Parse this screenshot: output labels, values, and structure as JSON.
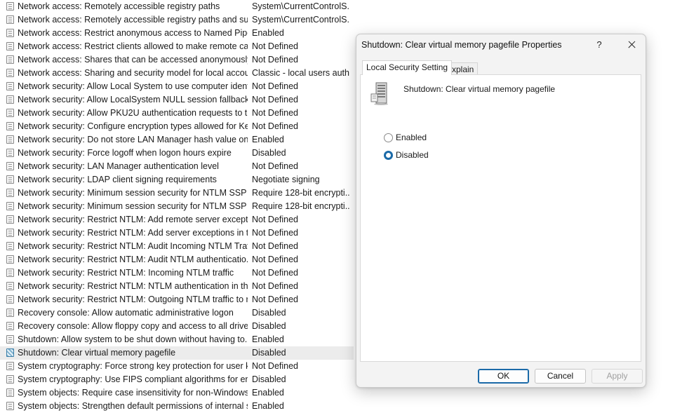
{
  "policies": [
    {
      "name": "Network access: Remotely accessible registry paths",
      "setting": "System\\CurrentControlS..."
    },
    {
      "name": "Network access: Remotely accessible registry paths and sub...",
      "setting": "System\\CurrentControlS..."
    },
    {
      "name": "Network access: Restrict anonymous access to Named Pipes...",
      "setting": "Enabled"
    },
    {
      "name": "Network access: Restrict clients allowed to make remote call...",
      "setting": "Not Defined"
    },
    {
      "name": "Network access: Shares that can be accessed anonymously",
      "setting": "Not Defined"
    },
    {
      "name": "Network access: Sharing and security model for local accou...",
      "setting": "Classic - local users auth..."
    },
    {
      "name": "Network security: Allow Local System to use computer ident...",
      "setting": "Not Defined"
    },
    {
      "name": "Network security: Allow LocalSystem NULL session fallback",
      "setting": "Not Defined"
    },
    {
      "name": "Network security: Allow PKU2U authentication requests to t...",
      "setting": "Not Defined"
    },
    {
      "name": "Network security: Configure encryption types allowed for Ke...",
      "setting": "Not Defined"
    },
    {
      "name": "Network security: Do not store LAN Manager hash value on ...",
      "setting": "Enabled"
    },
    {
      "name": "Network security: Force logoff when logon hours expire",
      "setting": "Disabled"
    },
    {
      "name": "Network security: LAN Manager authentication level",
      "setting": "Not Defined"
    },
    {
      "name": "Network security: LDAP client signing requirements",
      "setting": "Negotiate signing"
    },
    {
      "name": "Network security: Minimum session security for NTLM SSP ...",
      "setting": "Require 128-bit encrypti..."
    },
    {
      "name": "Network security: Minimum session security for NTLM SSP ...",
      "setting": "Require 128-bit encrypti..."
    },
    {
      "name": "Network security: Restrict NTLM: Add remote server excepti...",
      "setting": "Not Defined"
    },
    {
      "name": "Network security: Restrict NTLM: Add server exceptions in t...",
      "setting": "Not Defined"
    },
    {
      "name": "Network security: Restrict NTLM: Audit Incoming NTLM Traf...",
      "setting": "Not Defined"
    },
    {
      "name": "Network security: Restrict NTLM: Audit NTLM authenticatio...",
      "setting": "Not Defined"
    },
    {
      "name": "Network security: Restrict NTLM: Incoming NTLM traffic",
      "setting": "Not Defined"
    },
    {
      "name": "Network security: Restrict NTLM: NTLM authentication in thi...",
      "setting": "Not Defined"
    },
    {
      "name": "Network security: Restrict NTLM: Outgoing NTLM traffic to r...",
      "setting": "Not Defined"
    },
    {
      "name": "Recovery console: Allow automatic administrative logon",
      "setting": "Disabled"
    },
    {
      "name": "Recovery console: Allow floppy copy and access to all drives...",
      "setting": "Disabled"
    },
    {
      "name": "Shutdown: Allow system to be shut down without having to...",
      "setting": "Enabled"
    },
    {
      "name": "Shutdown: Clear virtual memory pagefile",
      "setting": "Disabled",
      "selected": true
    },
    {
      "name": "System cryptography: Force strong key protection for user k...",
      "setting": "Not Defined"
    },
    {
      "name": "System cryptography: Use FIPS compliant algorithms for en...",
      "setting": "Disabled"
    },
    {
      "name": "System objects: Require case insensitivity for non-Windows ...",
      "setting": "Enabled"
    },
    {
      "name": "System objects: Strengthen default permissions of internal s...",
      "setting": "Enabled"
    }
  ],
  "dialog": {
    "title": "Shutdown: Clear virtual memory pagefile Properties",
    "help": "?",
    "tabs": [
      "Local Security Setting",
      "Explain"
    ],
    "policy_name": "Shutdown: Clear virtual memory pagefile",
    "options": [
      {
        "label": "Enabled",
        "checked": false
      },
      {
        "label": "Disabled",
        "checked": true
      }
    ],
    "buttons": {
      "ok": "OK",
      "cancel": "Cancel",
      "apply": "Apply"
    },
    "accent_color": "#1b6aa8"
  }
}
